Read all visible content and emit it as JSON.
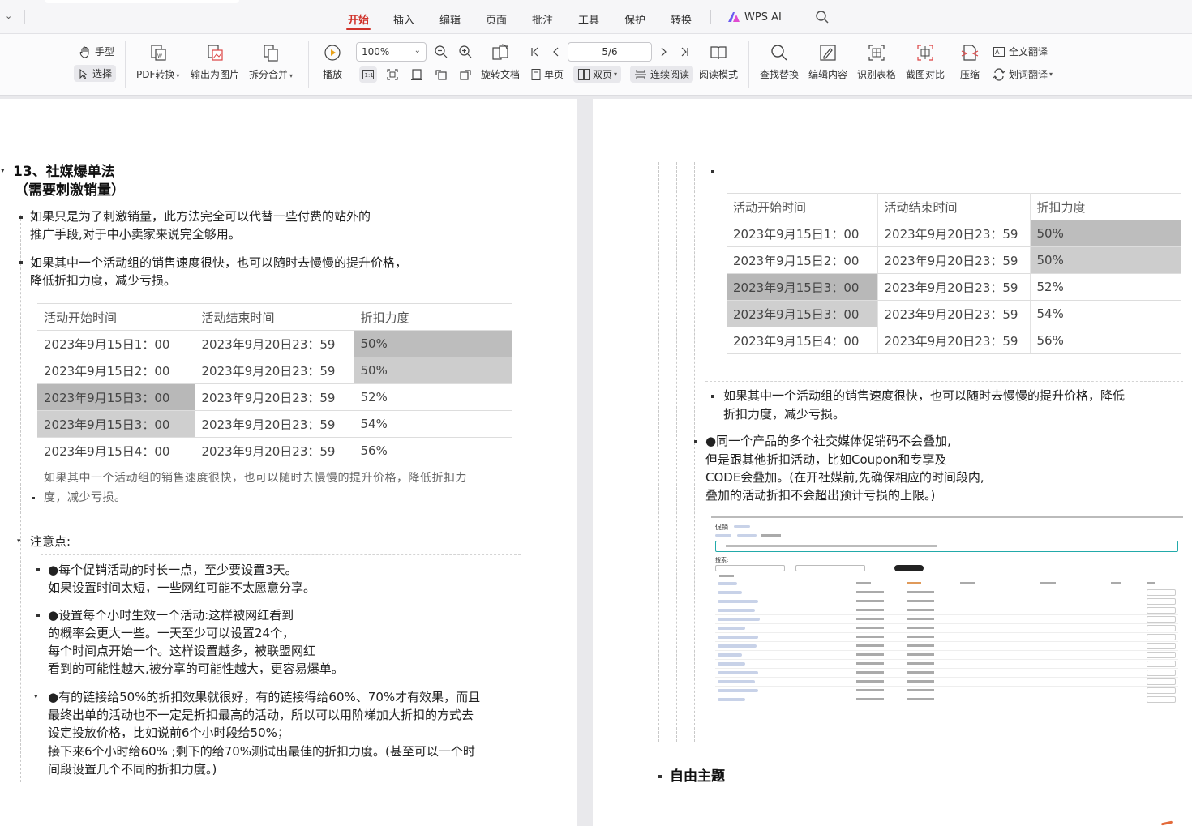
{
  "menu": {
    "tabs": [
      "开始",
      "插入",
      "编辑",
      "页面",
      "批注",
      "工具",
      "保护",
      "转换"
    ],
    "active": "开始",
    "wps_ai": "WPS AI"
  },
  "toolbar": {
    "hand": "手型",
    "select": "选择",
    "pdf_convert": "PDF转换",
    "export_image": "输出为图片",
    "split_merge": "拆分合并",
    "play": "播放",
    "zoom": "100%",
    "rotate": "旋转文档",
    "page_indicator": "5/6",
    "single": "单页",
    "double": "双页",
    "continuous": "连续阅读",
    "read_mode": "阅读模式",
    "find_replace": "查找替换",
    "edit_content": "编辑内容",
    "recognize_table": "识别表格",
    "screenshot_compare": "截图对比",
    "compress": "压缩",
    "full_translate": "全文翻译",
    "word_translate": "划词翻译"
  },
  "left_page": {
    "heading_line1": "13、社媒爆单法",
    "heading_line2": "（需要刺激销量）",
    "p1_l1": "如果只是为了刺激销量，此方法完全可以代替一些付费的站外的",
    "p1_l2": "推广手段,对于中小卖家来说完全够用。",
    "p2_l1": "如果其中一个活动组的销售速度很快，也可以随时去慢慢的提升价格，",
    "p2_l2": "降低折扣力度，减少亏损。",
    "table": {
      "headers": [
        "活动开始时间",
        "活动结束时间",
        "折扣力度"
      ],
      "rows": [
        [
          "2023年9月15日1：00",
          "2023年9月20日23：59",
          "50%"
        ],
        [
          "2023年9月15日2：00",
          "2023年9月20日23：59",
          "50%"
        ],
        [
          "2023年9月15日3：00",
          "2023年9月20日23：59",
          "52%"
        ],
        [
          "2023年9月15日3：00",
          "2023年9月20日23：59",
          "54%"
        ],
        [
          "2023年9月15日4：00",
          "2023年9月20日23：59",
          "56%"
        ]
      ]
    },
    "caption_l1": "如果其中一个活动组的销售速度很快，也可以随时去慢慢的提升价格，降低折扣力",
    "caption_l2": "度，减少亏损。",
    "notes_title": "注意点:",
    "n1_l1": "●每个促销活动的时长一点，至少要设置3天。",
    "n1_l2": "如果设置时间太短，一些网红可能不太愿意分享。",
    "n2_l1": "●设置每个小时生效一个活动:这样被网红看到",
    "n2_l2": "的概率会更大一些。一天至少可以设置24个，",
    "n2_l3": "每个时间点开始一个。这样设置越多，被联盟网红",
    "n2_l4": "看到的可能性越大,被分享的可能性越大，更容易爆单。",
    "n3_l1": "●有的链接给50%的折扣效果就很好，有的链接得给60%、70%才有效果，而且",
    "n3_l2": "最终出单的活动也不一定是折扣最高的活动，所以可以用阶梯加大折扣的方式去",
    "n3_l3": "设定投放价格，比如说前6个小时段给50%；",
    "n3_l4": "接下来6个小时给60% ;剩下的给70%测试出最佳的折扣力度。(甚至可以一个时",
    "n3_l5": "间段设置几个不同的折扣力度。)"
  },
  "right_page": {
    "table": {
      "headers": [
        "活动开始时间",
        "活动结束时间",
        "折扣力度"
      ],
      "rows": [
        [
          "2023年9月15日1：00",
          "2023年9月20日23：59",
          "50%"
        ],
        [
          "2023年9月15日2：00",
          "2023年9月20日23：59",
          "50%"
        ],
        [
          "2023年9月15日3：00",
          "2023年9月20日23：59",
          "52%"
        ],
        [
          "2023年9月15日3：00",
          "2023年9月20日23：59",
          "54%"
        ],
        [
          "2023年9月15日4：00",
          "2023年9月20日23：59",
          "56%"
        ]
      ]
    },
    "p1_l1": "如果其中一个活动组的销售速度很快，也可以随时去慢慢的提升价格，降低",
    "p1_l2": "折扣力度，减少亏损。",
    "p2_l1": "●同一个产品的多个社交媒体促销码不会叠加,",
    "p2_l2": "但是跟其他折扣活动，比如Coupon和专享及",
    "p2_l3": "CODE会叠加。(在开社媒前,先确保相应的时间段内,",
    "p2_l4": "叠加的活动折扣不会超出预计亏损的上限。)",
    "mini_title": "促销",
    "mini_search": "搜索:",
    "free_topic": "自由主题"
  },
  "colors": {
    "accent": "#d0322a",
    "cell_dark": "#bdbdbd",
    "cell_light": "#cdcdcd"
  }
}
